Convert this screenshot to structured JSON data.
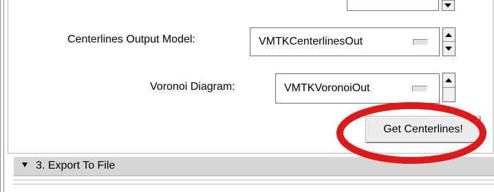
{
  "form": {
    "centerlines_output_model": {
      "label": "Centerlines Output Model:",
      "value": "VMTKCenterlinesOut"
    },
    "voronoi_diagram": {
      "label": "Voronoi Diagram:",
      "value": "VMTKVoronoiOut"
    },
    "get_centerlines_button": {
      "label": "Get Centerlines!"
    }
  },
  "sections": [
    {
      "label": "3. Export To File"
    }
  ],
  "annotation": {
    "color": "#e01818",
    "shape": "ellipse"
  }
}
